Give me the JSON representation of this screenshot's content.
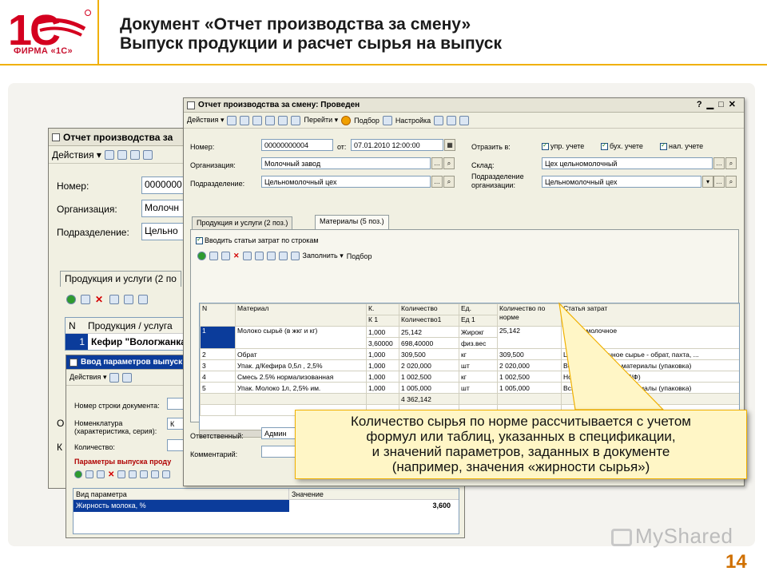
{
  "brand": {
    "logo_alt": "1С",
    "company": "ФИРМА «1С»"
  },
  "header": {
    "title_line1": "Документ «Отчет производства за смену»",
    "title_line2": "Выпуск продукции и расчет сырья на выпуск"
  },
  "back_window": {
    "title": "Отчет производства за",
    "actions": "Действия",
    "fields": [
      {
        "label": "Номер:",
        "value": "0000000"
      },
      {
        "label": "Организация:",
        "value": "Молочн"
      },
      {
        "label": "Подразделение:",
        "value": "Цельно"
      }
    ],
    "tab": "Продукция и услуги (2 по",
    "grid_headers": [
      "N",
      "Продукция / услуга"
    ],
    "row": {
      "n": "1",
      "name": "Кефир \"Вологжанка"
    },
    "side_letters": [
      "О",
      "К"
    ]
  },
  "param_window": {
    "title": "Ввод параметров выпуск",
    "actions": "Действия",
    "fields": [
      {
        "label": "Номер строки документа:"
      },
      {
        "label": "Номенклатура (характеристика, серия):",
        "value": "К"
      },
      {
        "label": "Количество:"
      }
    ],
    "section": "Параметры выпуска проду",
    "grid_headers": [
      "Вид параметра",
      "Значение"
    ],
    "row": {
      "param": "Жирность молока, %",
      "value": "3,600"
    }
  },
  "main_window": {
    "title": "Отчет производства за смену: Проведен",
    "toolbar": {
      "actions": "Действия",
      "goto": "Перейти",
      "select": "Подбор",
      "settings": "Настройка"
    },
    "number_label": "Номер:",
    "number": "00000000004",
    "date_label": "от:",
    "date": "07.01.2010 12:00:00",
    "org_label": "Организация:",
    "org": "Молочный завод",
    "dept_label": "Подразделение:",
    "dept": "Цельномолочный цех",
    "reflect_label": "Отразить в:",
    "reflect": [
      "упр. учете",
      "бух. учете",
      "нал. учете"
    ],
    "warehouse_label": "Склад:",
    "warehouse": "Цех цельномолочный",
    "dept_org_label": "Подразделение организации:",
    "dept_org": "Цельномолочный цех",
    "tabs": [
      "Продукция и услуги (2 поз.)",
      "Материалы (5 поз.)"
    ],
    "cost_items_cb": "Вводить статьи затрат по строкам",
    "fill": "Заполнить",
    "select": "Подбор",
    "grid": {
      "headers": {
        "n": "N",
        "material": "Материал",
        "k": "К.",
        "k1": "К 1",
        "qty": "Количество",
        "qty1": "Количество1",
        "unit": "Ед.",
        "unit1": "Ед 1",
        "norm": "Количество по норме",
        "cost": "Статья затрат"
      },
      "rows": [
        {
          "n": "1",
          "material": "Молоко сырьё (в жкг и кг)",
          "k": "1,000",
          "qty": "25,142",
          "unit": "Жирокг",
          "norm": "25,142",
          "cost": "Сырье молочное",
          "k1": "3,60000",
          "qty1": "698,40000",
          "unit1": "физ.вес"
        },
        {
          "n": "2",
          "material": "Обрат",
          "k": "1,000",
          "qty": "309,500",
          "unit": "кг",
          "norm": "309,500",
          "cost": "Цельное молочное сырье - обрат, пахта, ..."
        },
        {
          "n": "3",
          "material": "Упак. д/Кефира 0,5л , 2,5%",
          "k": "1,000",
          "qty": "2 020,000",
          "unit": "шт",
          "norm": "2 020,000",
          "cost": "Вспомогательные материалы (упаковка)"
        },
        {
          "n": "4",
          "material": "Смесь 2.5% нормализованная",
          "k": "1,000",
          "qty": "1 002,500",
          "unit": "кг",
          "norm": "1 002,500",
          "cost": "Нормализованные (П/Ф)"
        },
        {
          "n": "5",
          "material": "Упак. Молоко 1л, 2,5% им.",
          "k": "1,000",
          "qty": "1 005,000",
          "unit": "шт",
          "norm": "1 005,000",
          "cost": "Вспомогательные материалы (упаковка)"
        }
      ],
      "total_qty": "4 362,142"
    },
    "responsible_label": "Ответственный:",
    "responsible": "Админ",
    "comment_label": "Комментарий:"
  },
  "callout": {
    "line1": "Количество сырья по норме рассчитывается с учетом",
    "line2": "формул или таблиц, указанных в спецификации,",
    "line3": "и значений параметров, заданных в документе",
    "line4": "(например, значения «жирности сырья»)"
  },
  "page_number": "14",
  "watermark": "MyShared"
}
